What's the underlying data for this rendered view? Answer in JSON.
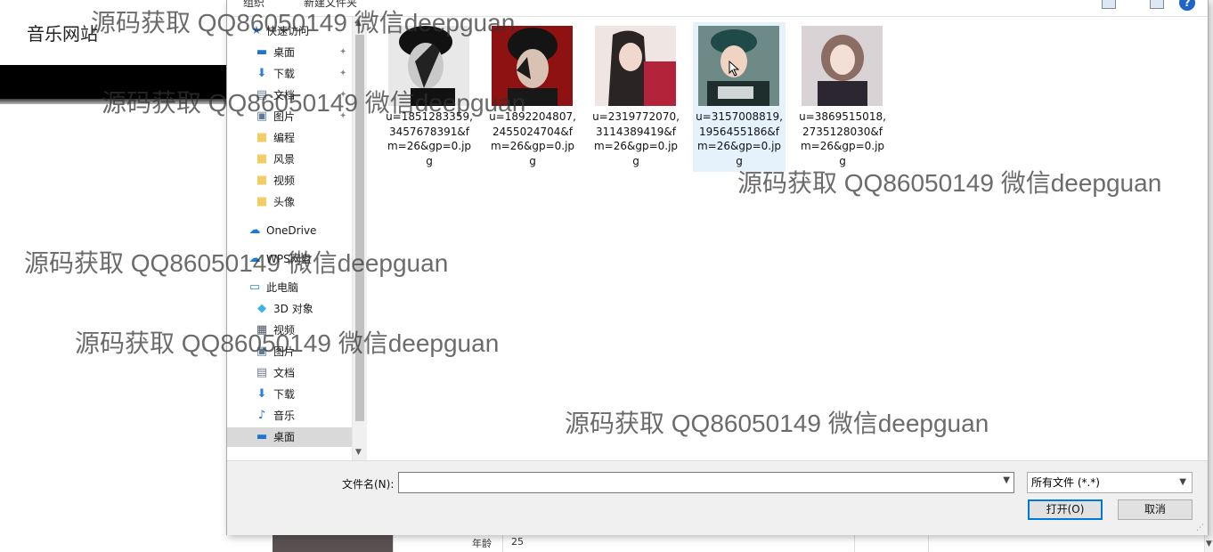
{
  "background_page": {
    "site_title": "音乐网站",
    "profile_row": {
      "label": "年龄",
      "value": "25"
    }
  },
  "dialog": {
    "toolbar": {
      "organize": "组织",
      "new_folder": "新建文件夹"
    },
    "nav": [
      {
        "label": "快速访问",
        "icon": "star-icon"
      },
      {
        "label": "桌面",
        "icon": "desktop-icon",
        "pinned": true
      },
      {
        "label": "下载",
        "icon": "download-icon",
        "pinned": true
      },
      {
        "label": "文档",
        "icon": "document-icon",
        "pinned": true
      },
      {
        "label": "图片",
        "icon": "picture-icon",
        "pinned": true
      },
      {
        "label": "编程",
        "icon": "folder-icon"
      },
      {
        "label": "风景",
        "icon": "folder-icon"
      },
      {
        "label": "视频",
        "icon": "folder-icon"
      },
      {
        "label": "头像",
        "icon": "folder-icon"
      },
      {
        "label": "OneDrive",
        "icon": "cloud-icon"
      },
      {
        "label": "WPS网盘",
        "icon": "cloud-icon"
      },
      {
        "label": "此电脑",
        "icon": "computer-icon"
      },
      {
        "label": "3D 对象",
        "icon": "cube-icon"
      },
      {
        "label": "视频",
        "icon": "video-icon"
      },
      {
        "label": "图片",
        "icon": "picture-icon"
      },
      {
        "label": "文档",
        "icon": "document-icon"
      },
      {
        "label": "下载",
        "icon": "download-icon"
      },
      {
        "label": "音乐",
        "icon": "music-icon"
      },
      {
        "label": "桌面",
        "icon": "desktop-icon",
        "selected": true
      }
    ],
    "files": [
      {
        "name": "u=1851283359,3457678391&fm=26&gp=0.jpg"
      },
      {
        "name": "u=1892204807,2455024704&fm=26&gp=0.jpg"
      },
      {
        "name": "u=2319772070,3114389419&fm=26&gp=0.jpg"
      },
      {
        "name": "u=3157008819,1956455186&fm=26&gp=0.jpg",
        "selected": true
      },
      {
        "name": "u=3869515018,2735128030&fm=26&gp=0.jpg"
      }
    ],
    "filename_label": "文件名(N):",
    "filename_value": "",
    "file_type": "所有文件 (*.*)",
    "open_button": "打开(O)",
    "cancel_button": "取消"
  },
  "watermark": "源码获取 QQ86050149 微信deepguan",
  "colors": {
    "accent": "#0078d7",
    "selected_nav": "#d9d9d9",
    "selected_file": "#e5f1fb"
  }
}
